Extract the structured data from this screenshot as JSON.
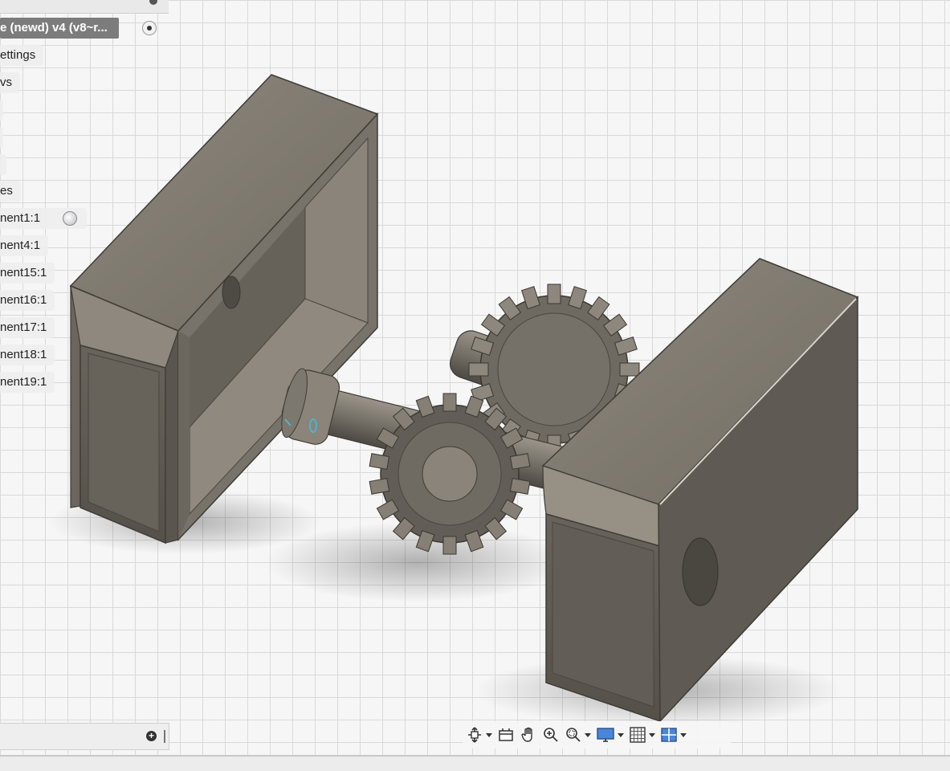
{
  "browser": {
    "root_label": "e (newd) v4 (v8~r...",
    "items": [
      {
        "label": "ettings"
      },
      {
        "label": "vs"
      },
      {
        "label": "es"
      },
      {
        "label": "nent1:1"
      },
      {
        "label": "nent4:1"
      },
      {
        "label": "nent15:1"
      },
      {
        "label": "nent16:1"
      },
      {
        "label": "nent17:1"
      },
      {
        "label": "nent18:1"
      },
      {
        "label": "nent19:1"
      }
    ]
  },
  "comments": {
    "add_icon": "plus-circle-icon"
  },
  "nav_toolbar": {
    "tools": [
      {
        "name": "orbit-icon"
      },
      {
        "name": "look-at-icon"
      },
      {
        "name": "pan-icon"
      },
      {
        "name": "zoom-icon"
      },
      {
        "name": "zoom-window-icon"
      },
      {
        "name": "display-settings-icon"
      },
      {
        "name": "grid-settings-icon"
      },
      {
        "name": "viewports-icon"
      }
    ]
  },
  "colors": {
    "body_top": "#7f7a71",
    "body_side": "#5d5952",
    "inner": "#6e6a62",
    "grid": "#d9d9d9",
    "accent_icon": "#2f6fd6"
  }
}
